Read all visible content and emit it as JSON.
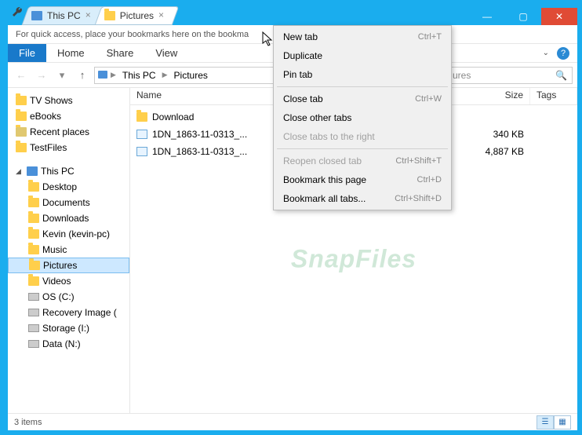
{
  "tabs": [
    {
      "label": "This PC",
      "active": false
    },
    {
      "label": "Pictures",
      "active": true
    }
  ],
  "bookmark_hint": "For quick access, place your bookmarks here on the bookma",
  "ribbon": {
    "file": "File",
    "tabs": [
      "Home",
      "Share",
      "View"
    ]
  },
  "breadcrumb": [
    "This PC",
    "Pictures"
  ],
  "search_placeholder": "ures",
  "columns": {
    "name": "Name",
    "size": "Size",
    "tags": "Tags"
  },
  "tree": {
    "favs": [
      "TV Shows",
      "eBooks",
      "Recent places",
      "TestFiles"
    ],
    "pc_label": "This PC",
    "pc_items": [
      "Desktop",
      "Documents",
      "Downloads",
      "Kevin (kevin-pc)",
      "Music",
      "Pictures",
      "Videos",
      "OS (C:)",
      "Recovery Image (",
      "Storage (I:)",
      "Data (N:)"
    ],
    "selected": "Pictures"
  },
  "files": [
    {
      "name": "Download",
      "type": "folder",
      "size": ""
    },
    {
      "name": "1DN_1863-11-0313_...",
      "type": "image",
      "size": "340 KB"
    },
    {
      "name": "1DN_1863-11-0313_...",
      "type": "image",
      "size": "4,887 KB"
    }
  ],
  "context_menu": [
    {
      "label": "New tab",
      "shortcut": "Ctrl+T",
      "enabled": true
    },
    {
      "label": "Duplicate",
      "shortcut": "",
      "enabled": true
    },
    {
      "label": "Pin tab",
      "shortcut": "",
      "enabled": true
    },
    {
      "sep": true
    },
    {
      "label": "Close tab",
      "shortcut": "Ctrl+W",
      "enabled": true
    },
    {
      "label": "Close other tabs",
      "shortcut": "",
      "enabled": true
    },
    {
      "label": "Close tabs to the right",
      "shortcut": "",
      "enabled": false
    },
    {
      "sep": true
    },
    {
      "label": "Reopen closed tab",
      "shortcut": "Ctrl+Shift+T",
      "enabled": false
    },
    {
      "label": "Bookmark this page",
      "shortcut": "Ctrl+D",
      "enabled": true
    },
    {
      "label": "Bookmark all tabs...",
      "shortcut": "Ctrl+Shift+D",
      "enabled": true
    }
  ],
  "status": "3 items",
  "watermark": "SnapFiles"
}
